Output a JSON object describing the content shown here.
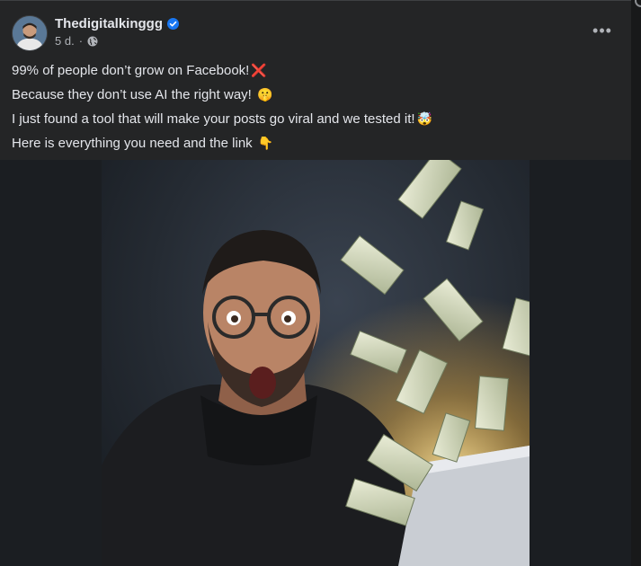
{
  "post": {
    "author": "Thedigitalkinggg",
    "timestamp": "5 d.",
    "more_label": "•••",
    "caption": [
      {
        "text": "99% of people don’t grow on Facebook!",
        "emoji": "❌"
      },
      {
        "text": "Because they don’t use AI the right way! ",
        "emoji": "🤫"
      },
      {
        "text": "I just found a tool that will make your posts go viral and we tested it!",
        "emoji": "🤯"
      },
      {
        "text": "Here is everything you need and the link ",
        "emoji": "👇"
      }
    ],
    "icons": {
      "verified": "verified-badge-icon",
      "privacy": "globe-icon",
      "more": "more-options-icon"
    }
  },
  "colors": {
    "background": "#18191a",
    "card": "#242526",
    "text_primary": "#e4e6eb",
    "text_secondary": "#b0b3b8",
    "verified_blue": "#1877f2"
  }
}
